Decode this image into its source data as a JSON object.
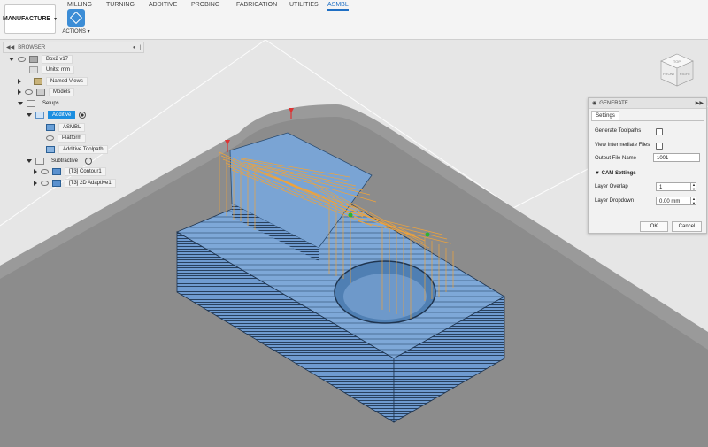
{
  "ribbon": {
    "tabs": [
      {
        "label": "MILLING",
        "active": false
      },
      {
        "label": "TURNING",
        "active": false
      },
      {
        "label": "ADDITIVE",
        "active": false
      },
      {
        "label": "PROBING",
        "active": false
      },
      {
        "label": "FABRICATION",
        "active": false
      },
      {
        "label": "UTILITIES",
        "active": false
      },
      {
        "label": "ASMBL",
        "active": true
      }
    ],
    "workspace_label": "MANUFACTURE",
    "actions_label": "ACTIONS"
  },
  "browser": {
    "title": "BROWSER",
    "items": [
      {
        "label": "Box2 v17"
      },
      {
        "label": "Units: mm"
      },
      {
        "label": "Named Views"
      },
      {
        "label": "Models"
      },
      {
        "label": "Setups"
      },
      {
        "label": "Additive"
      },
      {
        "label": "ASMBL"
      },
      {
        "label": "Platform"
      },
      {
        "label": "Additive Toolpath"
      },
      {
        "label": "Subtractive"
      },
      {
        "label": "[T3] Contour1"
      },
      {
        "label": "[T3] 2D Adaptive1"
      }
    ]
  },
  "generate_panel": {
    "title": "GENERATE",
    "tab": "Settings",
    "generate_toolpaths_label": "Generate Toolpaths",
    "view_intermediate_label": "View Intermediate Files",
    "output_file_label": "Output File Name",
    "output_file_value": "1001",
    "cam_settings_label": "CAM Settings",
    "layer_overlap_label": "Layer Overlap",
    "layer_overlap_value": "1",
    "layer_dropdown_label": "Layer Dropdown",
    "layer_dropdown_value": "0.00 mm",
    "ok_label": "OK",
    "cancel_label": "Cancel"
  },
  "viewcube": {
    "faces": [
      "TOP",
      "FRONT",
      "RIGHT"
    ]
  },
  "colors": {
    "accent": "#1f6fc4",
    "selected": "#1b8ee0",
    "toolpath": "#f0a33a",
    "part": "#5f8fc4"
  }
}
